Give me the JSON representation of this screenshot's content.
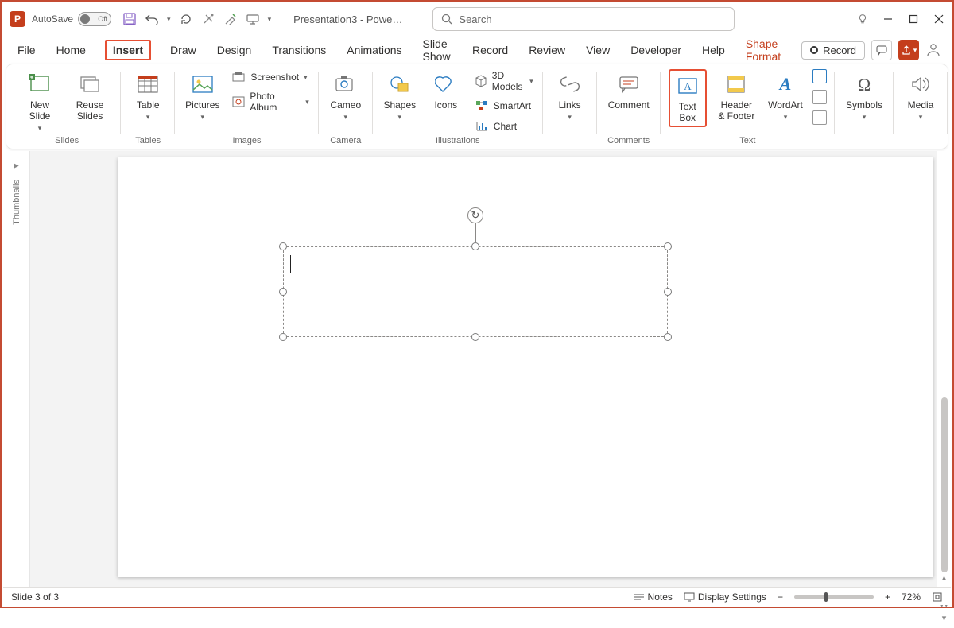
{
  "titlebar": {
    "autosave_label": "AutoSave",
    "autosave_state": "Off",
    "doc_title": "Presentation3 - Powe…",
    "search_placeholder": "Search"
  },
  "tabs": {
    "file": "File",
    "home": "Home",
    "insert": "Insert",
    "draw": "Draw",
    "design": "Design",
    "transitions": "Transitions",
    "animations": "Animations",
    "slideshow": "Slide Show",
    "record": "Record",
    "review": "Review",
    "view": "View",
    "developer": "Developer",
    "help": "Help",
    "shape_format": "Shape Format",
    "record_btn": "Record"
  },
  "ribbon": {
    "slides": {
      "label": "Slides",
      "new_slide": "New Slide",
      "reuse": "Reuse Slides"
    },
    "tables": {
      "label": "Tables",
      "table": "Table"
    },
    "images": {
      "label": "Images",
      "pictures": "Pictures",
      "screenshot": "Screenshot",
      "photo_album": "Photo Album"
    },
    "camera": {
      "label": "Camera",
      "cameo": "Cameo"
    },
    "illustrations": {
      "label": "Illustrations",
      "shapes": "Shapes",
      "icons": "Icons",
      "models": "3D Models",
      "smartart": "SmartArt",
      "chart": "Chart"
    },
    "links": {
      "label": "",
      "links": "Links"
    },
    "comments": {
      "label": "Comments",
      "comment": "Comment"
    },
    "text": {
      "label": "Text",
      "textbox": "Text Box",
      "header": "Header & Footer",
      "wordart": "WordArt"
    },
    "symbols": {
      "label": "",
      "symbols": "Symbols"
    },
    "media": {
      "label": "",
      "media": "Media"
    }
  },
  "thumbnails_label": "Thumbnails",
  "status": {
    "slide": "Slide 3 of 3",
    "notes": "Notes",
    "display": "Display Settings",
    "zoom": "72%"
  }
}
